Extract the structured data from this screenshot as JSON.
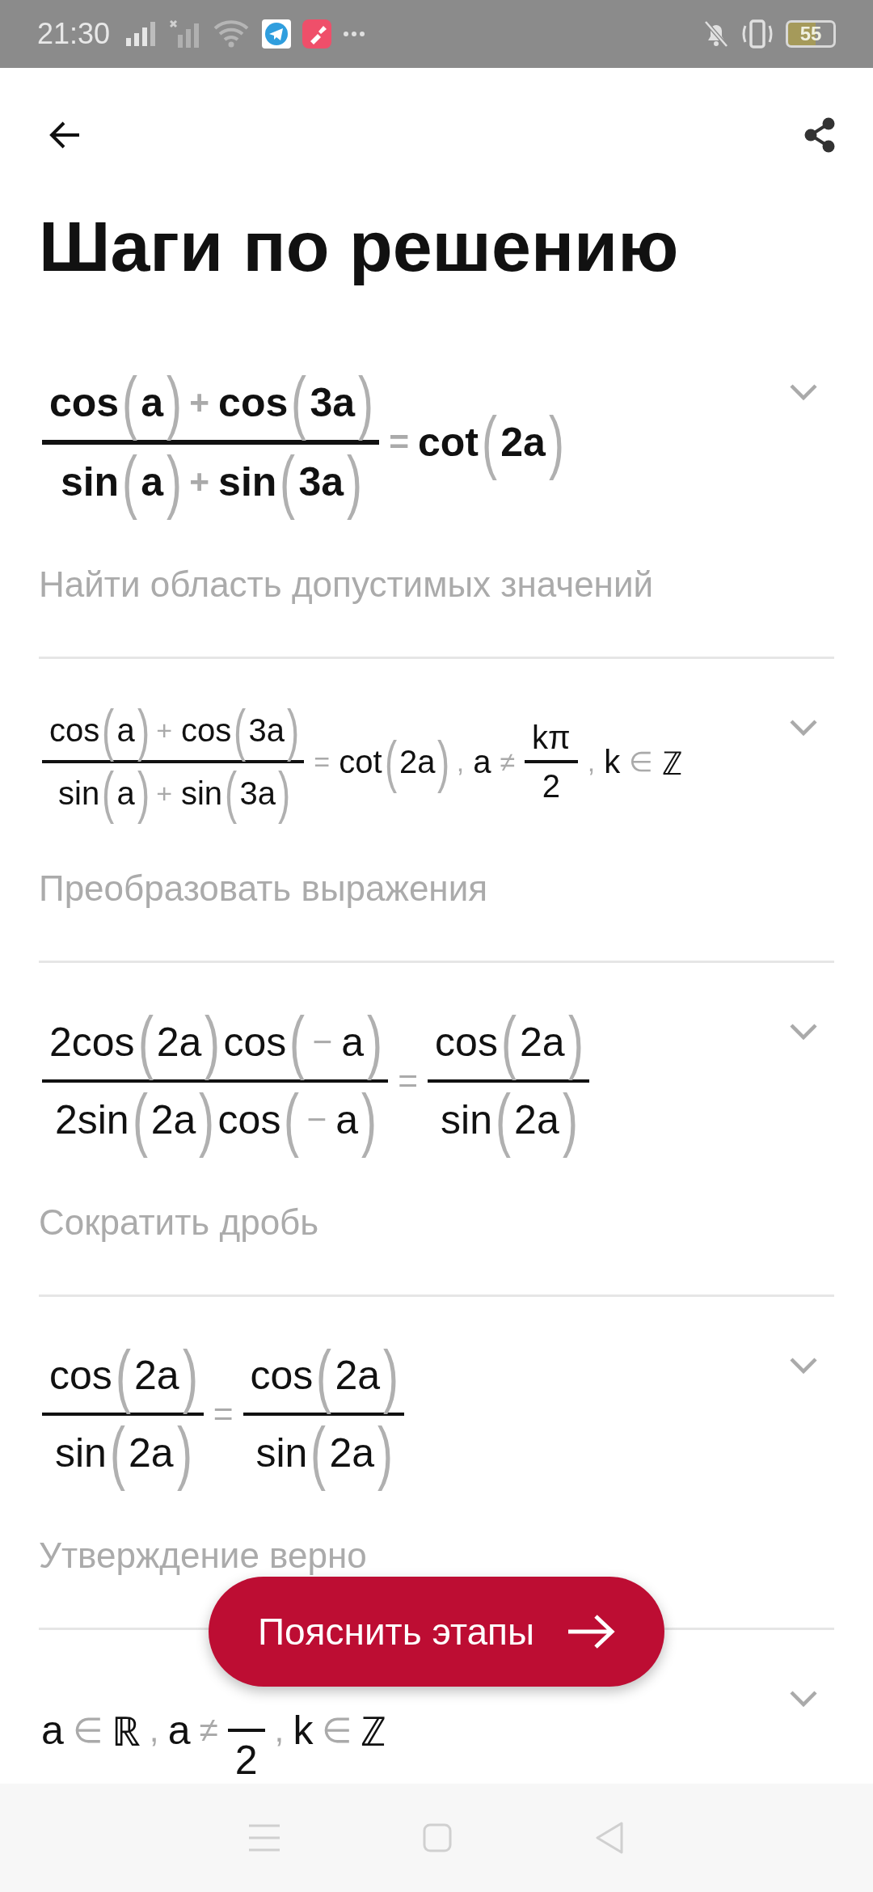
{
  "status_bar": {
    "time": "21:30",
    "battery": "55"
  },
  "title": "Шаги по решению",
  "steps": [
    {
      "bold": true,
      "compact": false,
      "expanded": false,
      "description": "Найти область допустимых значений",
      "formula": [
        {
          "kind": "frac",
          "num": [
            {
              "kind": "text",
              "text": "cos"
            },
            {
              "kind": "paren",
              "open": "(",
              "close": ")",
              "children": [
                {
                  "kind": "text",
                  "text": "a"
                }
              ]
            },
            {
              "kind": "op",
              "text": "+"
            },
            {
              "kind": "text",
              "text": "cos"
            },
            {
              "kind": "paren",
              "open": "(",
              "close": ")",
              "children": [
                {
                  "kind": "text",
                  "text": "3a"
                }
              ]
            }
          ],
          "den": [
            {
              "kind": "text",
              "text": "sin"
            },
            {
              "kind": "paren",
              "open": "(",
              "close": ")",
              "children": [
                {
                  "kind": "text",
                  "text": "a"
                }
              ]
            },
            {
              "kind": "op",
              "text": "+"
            },
            {
              "kind": "text",
              "text": "sin"
            },
            {
              "kind": "paren",
              "open": "(",
              "close": ")",
              "children": [
                {
                  "kind": "text",
                  "text": "3a"
                }
              ]
            }
          ]
        },
        {
          "kind": "op",
          "text": "="
        },
        {
          "kind": "text",
          "text": "cot"
        },
        {
          "kind": "paren",
          "open": "(",
          "close": ")",
          "children": [
            {
              "kind": "text",
              "text": "2a"
            }
          ]
        }
      ]
    },
    {
      "bold": false,
      "compact": true,
      "expanded": false,
      "description": "Преобразовать выражения",
      "formula": [
        {
          "kind": "frac",
          "num": [
            {
              "kind": "text",
              "text": "cos"
            },
            {
              "kind": "paren",
              "open": "(",
              "close": ")",
              "children": [
                {
                  "kind": "text",
                  "text": "a"
                }
              ]
            },
            {
              "kind": "op",
              "text": "+"
            },
            {
              "kind": "text",
              "text": "cos"
            },
            {
              "kind": "paren",
              "open": "(",
              "close": ")",
              "children": [
                {
                  "kind": "text",
                  "text": "3a"
                }
              ]
            }
          ],
          "den": [
            {
              "kind": "text",
              "text": "sin"
            },
            {
              "kind": "paren",
              "open": "(",
              "close": ")",
              "children": [
                {
                  "kind": "text",
                  "text": "a"
                }
              ]
            },
            {
              "kind": "op",
              "text": "+"
            },
            {
              "kind": "text",
              "text": "sin"
            },
            {
              "kind": "paren",
              "open": "(",
              "close": ")",
              "children": [
                {
                  "kind": "text",
                  "text": "3a"
                }
              ]
            }
          ]
        },
        {
          "kind": "op",
          "text": "="
        },
        {
          "kind": "text",
          "text": "cot"
        },
        {
          "kind": "paren",
          "open": "(",
          "close": ")",
          "children": [
            {
              "kind": "text",
              "text": "2a"
            }
          ]
        },
        {
          "kind": "op",
          "text": ","
        },
        {
          "kind": "text",
          "text": "a"
        },
        {
          "kind": "op",
          "text": "≠"
        },
        {
          "kind": "frac",
          "num": [
            {
              "kind": "text",
              "text": "kπ"
            }
          ],
          "den": [
            {
              "kind": "text",
              "text": "2"
            }
          ]
        },
        {
          "kind": "op",
          "text": ","
        },
        {
          "kind": "text",
          "text": "k"
        },
        {
          "kind": "op",
          "text": "∈"
        },
        {
          "kind": "text",
          "text": "ℤ"
        }
      ]
    },
    {
      "bold": false,
      "compact": false,
      "expanded": false,
      "description": "Сократить дробь",
      "formula": [
        {
          "kind": "frac",
          "num": [
            {
              "kind": "text",
              "text": "2cos"
            },
            {
              "kind": "paren",
              "open": "(",
              "close": ")",
              "children": [
                {
                  "kind": "text",
                  "text": "2a"
                }
              ]
            },
            {
              "kind": "text",
              "text": "cos"
            },
            {
              "kind": "paren",
              "open": "(",
              "close": ")",
              "children": [
                {
                  "kind": "op",
                  "text": "−"
                },
                {
                  "kind": "text",
                  "text": "a"
                }
              ]
            }
          ],
          "den": [
            {
              "kind": "text",
              "text": "2sin"
            },
            {
              "kind": "paren",
              "open": "(",
              "close": ")",
              "children": [
                {
                  "kind": "text",
                  "text": "2a"
                }
              ]
            },
            {
              "kind": "text",
              "text": "cos"
            },
            {
              "kind": "paren",
              "open": "(",
              "close": ")",
              "children": [
                {
                  "kind": "op",
                  "text": "−"
                },
                {
                  "kind": "text",
                  "text": "a"
                }
              ]
            }
          ]
        },
        {
          "kind": "op",
          "text": "="
        },
        {
          "kind": "frac",
          "num": [
            {
              "kind": "text",
              "text": "cos"
            },
            {
              "kind": "paren",
              "open": "(",
              "close": ")",
              "children": [
                {
                  "kind": "text",
                  "text": "2a"
                }
              ]
            }
          ],
          "den": [
            {
              "kind": "text",
              "text": "sin"
            },
            {
              "kind": "paren",
              "open": "(",
              "close": ")",
              "children": [
                {
                  "kind": "text",
                  "text": "2a"
                }
              ]
            }
          ]
        }
      ]
    },
    {
      "bold": false,
      "compact": false,
      "expanded": false,
      "description": "Утверждение верно",
      "formula": [
        {
          "kind": "frac",
          "num": [
            {
              "kind": "text",
              "text": "cos"
            },
            {
              "kind": "paren",
              "open": "(",
              "close": ")",
              "children": [
                {
                  "kind": "text",
                  "text": "2a"
                }
              ]
            }
          ],
          "den": [
            {
              "kind": "text",
              "text": "sin"
            },
            {
              "kind": "paren",
              "open": "(",
              "close": ")",
              "children": [
                {
                  "kind": "text",
                  "text": "2a"
                }
              ]
            }
          ]
        },
        {
          "kind": "op",
          "text": "="
        },
        {
          "kind": "frac",
          "num": [
            {
              "kind": "text",
              "text": "cos"
            },
            {
              "kind": "paren",
              "open": "(",
              "close": ")",
              "children": [
                {
                  "kind": "text",
                  "text": "2a"
                }
              ]
            }
          ],
          "den": [
            {
              "kind": "text",
              "text": "sin"
            },
            {
              "kind": "paren",
              "open": "(",
              "close": ")",
              "children": [
                {
                  "kind": "text",
                  "text": "2a"
                }
              ]
            }
          ]
        }
      ]
    },
    {
      "bold": false,
      "compact": false,
      "expanded": false,
      "formula": [
        {
          "kind": "text",
          "text": "a"
        },
        {
          "kind": "op",
          "text": "∈"
        },
        {
          "kind": "text",
          "text": "ℝ"
        },
        {
          "kind": "op",
          "text": ","
        },
        {
          "kind": "text",
          "text": "a"
        },
        {
          "kind": "op",
          "text": "≠"
        },
        {
          "kind": "frac",
          "den": [
            {
              "kind": "text",
              "text": "2"
            }
          ]
        },
        {
          "kind": "op",
          "text": ","
        },
        {
          "kind": "text",
          "text": "k"
        },
        {
          "kind": "op",
          "text": "∈"
        },
        {
          "kind": "text",
          "text": "ℤ"
        }
      ]
    }
  ],
  "explain_button": {
    "label": "Пояснить этапы"
  }
}
